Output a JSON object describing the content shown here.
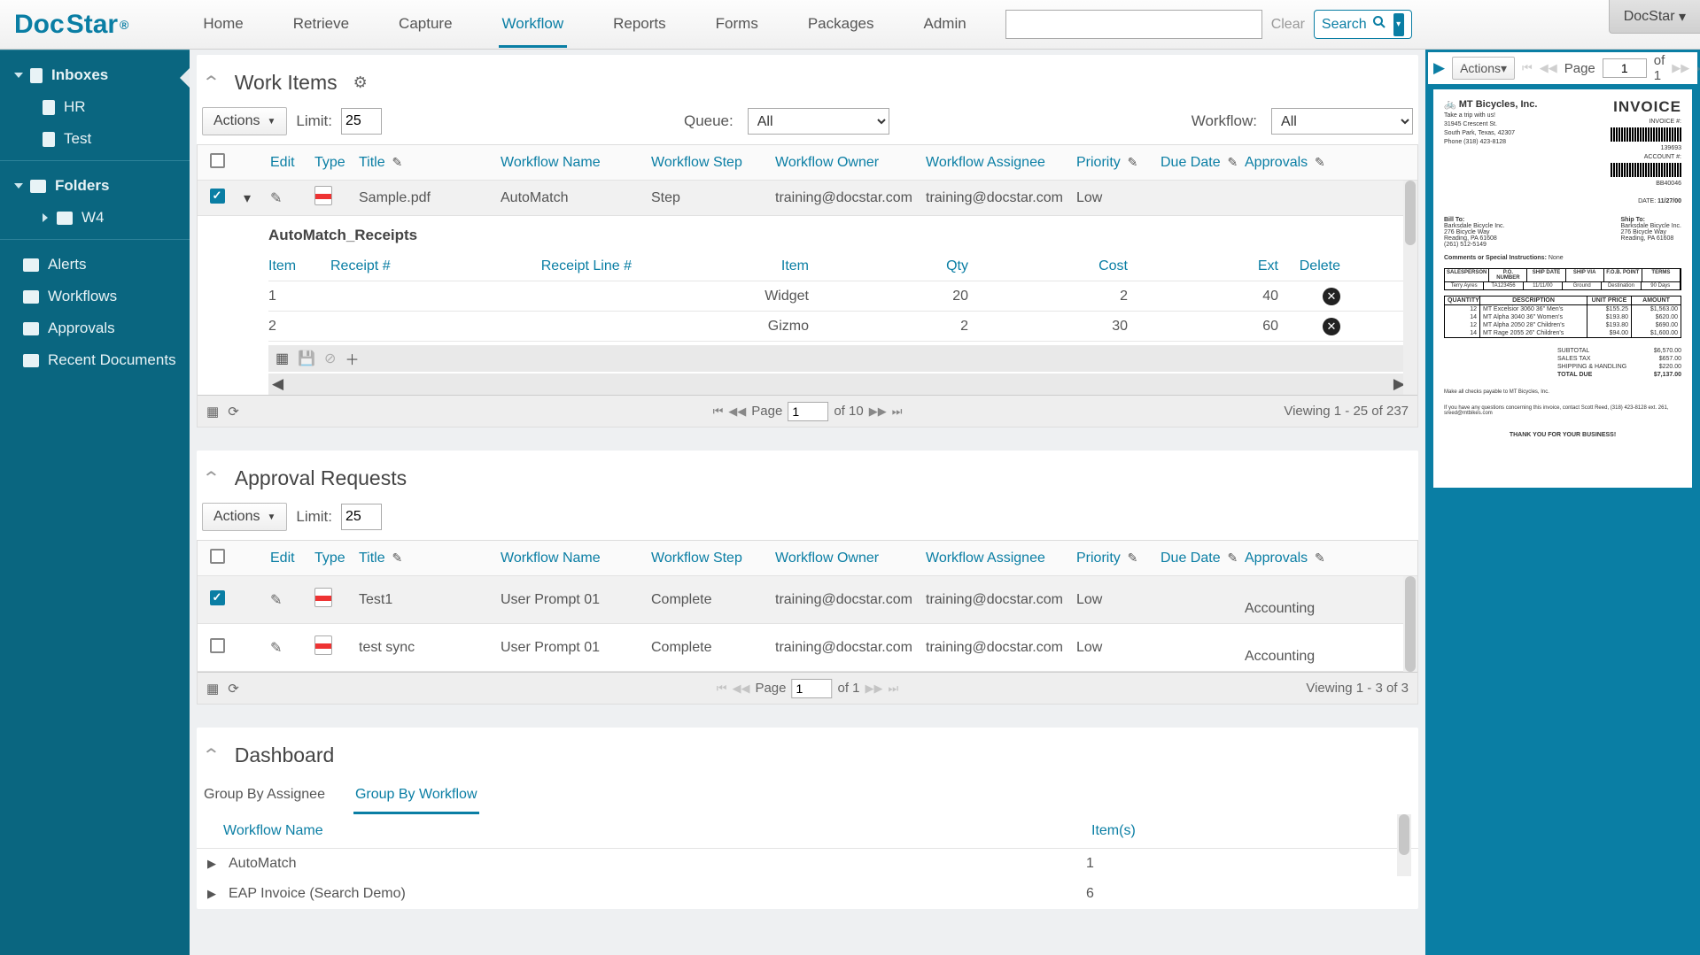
{
  "app": {
    "user_menu": "DocStar",
    "logo1": "Doc",
    "logo2": "Star"
  },
  "nav": [
    "Home",
    "Retrieve",
    "Capture",
    "Workflow",
    "Reports",
    "Forms",
    "Packages",
    "Admin"
  ],
  "nav_active": 3,
  "search": {
    "clear": "Clear",
    "label": "Search"
  },
  "sidebar": {
    "inboxes": {
      "label": "Inboxes",
      "children": [
        "HR",
        "Test"
      ]
    },
    "folders": {
      "label": "Folders",
      "children": [
        "W4"
      ]
    },
    "links": [
      "Alerts",
      "Workflows",
      "Approvals",
      "Recent Documents"
    ]
  },
  "workitems": {
    "title": "Work Items",
    "actions": "Actions",
    "limit_label": "Limit:",
    "limit": "25",
    "queue_label": "Queue:",
    "queue": "All",
    "wf_label": "Workflow:",
    "wf": "All",
    "headers": {
      "edit": "Edit",
      "type": "Type",
      "title": "Title",
      "wfname": "Workflow Name",
      "wfstep": "Workflow Step",
      "owner": "Workflow Owner",
      "assignee": "Workflow Assignee",
      "prio": "Priority",
      "due": "Due Date",
      "appr": "Approvals"
    },
    "row": {
      "title": "Sample.pdf",
      "wfname": "AutoMatch",
      "wfstep": "Step",
      "owner": "training@docstar.com",
      "assignee": "training@docstar.com",
      "prio": "Low"
    },
    "sub": {
      "title": "AutoMatch_Receipts",
      "headers": {
        "item": "Item",
        "rcpt": "Receipt #",
        "rline": "Receipt Line #",
        "sitem": "Item",
        "qty": "Qty",
        "cost": "Cost",
        "ext": "Ext",
        "del": "Delete"
      },
      "rows": [
        {
          "item": "1",
          "sitem": "Widget",
          "qty": "20",
          "cost": "2",
          "ext": "40"
        },
        {
          "item": "2",
          "sitem": "Gizmo",
          "qty": "2",
          "cost": "30",
          "ext": "60"
        }
      ]
    },
    "footer": {
      "page": "1",
      "of": "of 10",
      "status": "Viewing 1 - 25 of 237",
      "page_label": "Page"
    }
  },
  "approvals": {
    "title": "Approval Requests",
    "actions": "Actions",
    "limit_label": "Limit:",
    "limit": "25",
    "headers": {
      "edit": "Edit",
      "type": "Type",
      "title": "Title",
      "wfname": "Workflow Name",
      "wfstep": "Workflow Step",
      "owner": "Workflow Owner",
      "assignee": "Workflow Assignee",
      "prio": "Priority",
      "due": "Due Date",
      "appr": "Approvals"
    },
    "rows": [
      {
        "checked": true,
        "title": "Test1",
        "wfname": "User Prompt 01",
        "wfstep": "Complete",
        "owner": "training@docstar.com",
        "assignee": "training@docstar.com",
        "prio": "Low",
        "appr": "Accounting"
      },
      {
        "checked": false,
        "title": "test sync",
        "wfname": "User Prompt 01",
        "wfstep": "Complete",
        "owner": "training@docstar.com",
        "assignee": "training@docstar.com",
        "prio": "Low",
        "appr": "Accounting"
      }
    ],
    "footer": {
      "page": "1",
      "of": "of 1",
      "status": "Viewing 1 - 3 of 3",
      "page_label": "Page"
    }
  },
  "dashboard": {
    "title": "Dashboard",
    "tabs": [
      "Group By Assignee",
      "Group By Workflow"
    ],
    "active": 1,
    "headers": {
      "wf": "Workflow Name",
      "items": "Item(s)"
    },
    "rows": [
      {
        "wf": "AutoMatch",
        "items": "1"
      },
      {
        "wf": "EAP Invoice (Search Demo)",
        "items": "6"
      }
    ]
  },
  "preview": {
    "actions": "Actions",
    "page_label": "Page",
    "page": "1",
    "of": "of 1",
    "doc": {
      "company": "MT Bicycles, Inc.",
      "tag": "Take a trip with us!",
      "addr1": "31945 Crescent St.",
      "addr2": "South Park, Texas, 42307",
      "phone": "Phone (318) 423-8128",
      "invoice_h": "INVOICE",
      "invno_l": "INVOICE #:",
      "invno": "139693",
      "acct_l": "ACCOUNT #:",
      "acct": "BB40046",
      "date_l": "DATE:",
      "date": "11/27/00",
      "billto": "Bill To:",
      "shipto": "Ship To:",
      "bill": [
        "Barksdale Bicycle Inc.",
        "276 Bicycle Way",
        "Reading, PA 61608",
        "(261) 512-5149"
      ],
      "ship": [
        "Barksdale Bicycle Inc.",
        "276 Bicycle Way",
        "Reading, PA 61608"
      ],
      "comments_l": "Comments or Special Instructions:",
      "comments": "None",
      "thead": [
        "SALESPERSON",
        "P.O. NUMBER",
        "SHIP DATE",
        "SHIP VIA",
        "F.O.B. POINT",
        "TERMS"
      ],
      "trow": [
        "Terry Ayres",
        "TA123456",
        "11/11/00",
        "Ground",
        "Destination",
        "90 Days"
      ],
      "lhead": [
        "QUANTITY",
        "DESCRIPTION",
        "UNIT PRICE",
        "AMOUNT"
      ],
      "lines": [
        {
          "q": "12",
          "d": "MT Excelsior 3060 36\" Men's",
          "u": "$155.25",
          "a": "$1,563.00"
        },
        {
          "q": "14",
          "d": "MT Alpha 3040 36\" Women's",
          "u": "$193.80",
          "a": "$620.00"
        },
        {
          "q": "12",
          "d": "MT Alpha 2050 28\" Children's",
          "u": "$193.80",
          "a": "$690.00"
        },
        {
          "q": "14",
          "d": "MT Rage 2055 26\" Children's",
          "u": "$94.00",
          "a": "$1,600.00"
        }
      ],
      "totals": [
        [
          "SUBTOTAL",
          "$6,570.00"
        ],
        [
          "SALES TAX",
          "$657.00"
        ],
        [
          "SHIPPING & HANDLING",
          "$220.00"
        ],
        [
          "TOTAL DUE",
          "$7,137.00"
        ]
      ],
      "foot1": "Make all checks payable to MT Bicycles, Inc.",
      "foot2": "If you have any questions concerning this invoice, contact Scott Reed, (318) 423-8128 ext. 261, sreed@mtbikes.com",
      "thanks": "THANK YOU FOR YOUR BUSINESS!"
    }
  }
}
